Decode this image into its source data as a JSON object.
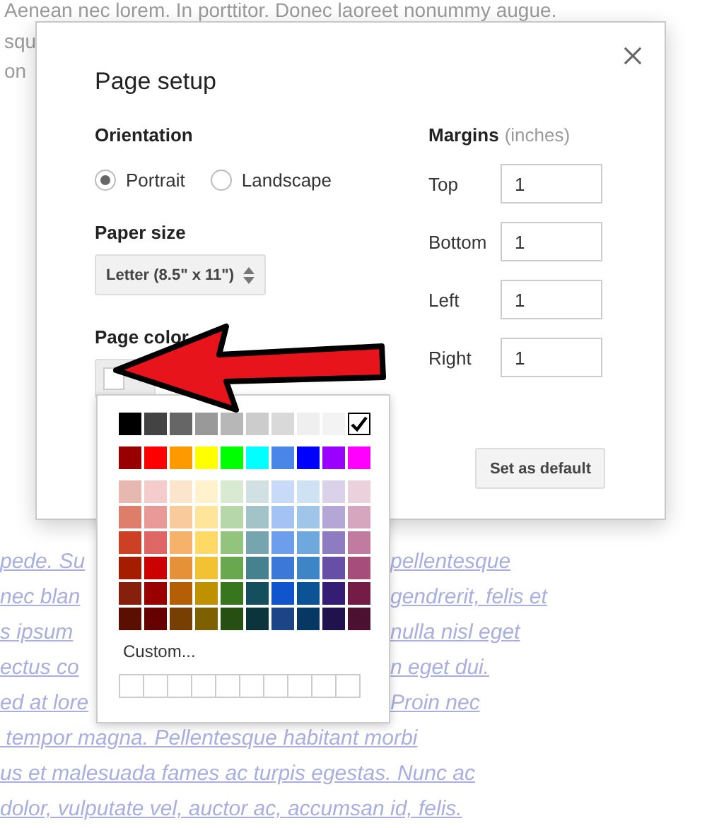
{
  "background_text": {
    "top_lines": [
      "Aenean nec lorem. In porttitor. Donec laoreet nonummy augue.",
      "squ",
      "on"
    ],
    "bottom_lines": [
      {
        "left": "pede. Su",
        "right": "pellentesque"
      },
      {
        "left": "nec blan",
        "right": "gendrerit, felis et"
      },
      {
        "left": "s ipsum",
        "right": "nulla nisl eget"
      },
      {
        "left": "ectus co",
        "right": "n eget dui."
      },
      {
        "left": "ed at lore",
        "right": "Proin nec"
      },
      {
        "left": " tempor magna. Pellentesque habitant morbi"
      },
      {
        "left": "us et malesuada fames ac turpis egestas. Nunc ac"
      },
      {
        "left": "dolor, vulputate vel, auctor ac, accumsan id, felis."
      }
    ]
  },
  "dialog": {
    "title": "Page setup",
    "orientation": {
      "label": "Orientation",
      "options": [
        {
          "label": "Portrait",
          "selected": true
        },
        {
          "label": "Landscape",
          "selected": false
        }
      ]
    },
    "paper_size": {
      "label": "Paper size",
      "value": "Letter (8.5\" x 11\")"
    },
    "page_color": {
      "label": "Page color",
      "color": "#ffffff"
    },
    "margins": {
      "label": "Margins",
      "unit": "(inches)",
      "fields": [
        {
          "label": "Top",
          "value": "1"
        },
        {
          "label": "Bottom",
          "value": "1"
        },
        {
          "label": "Left",
          "value": "1"
        },
        {
          "label": "Right",
          "value": "1"
        }
      ]
    },
    "buttons": [
      {
        "label": "Set as default"
      }
    ]
  },
  "color_menu": {
    "sections": [
      {
        "rows": [
          [
            {
              "color": "#000000",
              "selected": false
            },
            {
              "color": "#434343",
              "selected": false
            },
            {
              "color": "#666666",
              "selected": false
            },
            {
              "color": "#999999",
              "selected": false
            },
            {
              "color": "#b7b7b7",
              "selected": false
            },
            {
              "color": "#cccccc",
              "selected": false
            },
            {
              "color": "#d9d9d9",
              "selected": false
            },
            {
              "color": "#efefef",
              "selected": false
            },
            {
              "color": "#f3f3f3",
              "selected": false
            },
            {
              "color": "#ffffff",
              "selected": true
            }
          ]
        ]
      },
      {
        "rows": [
          [
            {
              "color": "#980000",
              "selected": false
            },
            {
              "color": "#ff0000",
              "selected": false
            },
            {
              "color": "#ff9900",
              "selected": false
            },
            {
              "color": "#ffff00",
              "selected": false
            },
            {
              "color": "#00ff00",
              "selected": false
            },
            {
              "color": "#00ffff",
              "selected": false
            },
            {
              "color": "#4a86e8",
              "selected": false
            },
            {
              "color": "#0000ff",
              "selected": false
            },
            {
              "color": "#9900ff",
              "selected": false
            },
            {
              "color": "#ff00ff",
              "selected": false
            }
          ]
        ]
      },
      {
        "rows": [
          [
            {
              "color": "#e6b8af",
              "selected": false
            },
            {
              "color": "#f4cccc",
              "selected": false
            },
            {
              "color": "#fce5cd",
              "selected": false
            },
            {
              "color": "#fff2cc",
              "selected": false
            },
            {
              "color": "#d9ead3",
              "selected": false
            },
            {
              "color": "#d0e0e3",
              "selected": false
            },
            {
              "color": "#c9daf8",
              "selected": false
            },
            {
              "color": "#cfe2f3",
              "selected": false
            },
            {
              "color": "#d9d2e9",
              "selected": false
            },
            {
              "color": "#ead1dc",
              "selected": false
            }
          ],
          [
            {
              "color": "#dd7e6b",
              "selected": false
            },
            {
              "color": "#ea9999",
              "selected": false
            },
            {
              "color": "#f9cb9c",
              "selected": false
            },
            {
              "color": "#ffe599",
              "selected": false
            },
            {
              "color": "#b6d7a8",
              "selected": false
            },
            {
              "color": "#a2c4c9",
              "selected": false
            },
            {
              "color": "#a4c2f4",
              "selected": false
            },
            {
              "color": "#9fc5e8",
              "selected": false
            },
            {
              "color": "#b4a7d6",
              "selected": false
            },
            {
              "color": "#d5a6bd",
              "selected": false
            }
          ],
          [
            {
              "color": "#cc4125",
              "selected": false
            },
            {
              "color": "#e06666",
              "selected": false
            },
            {
              "color": "#f6b26b",
              "selected": false
            },
            {
              "color": "#ffd966",
              "selected": false
            },
            {
              "color": "#93c47d",
              "selected": false
            },
            {
              "color": "#76a5af",
              "selected": false
            },
            {
              "color": "#6d9eeb",
              "selected": false
            },
            {
              "color": "#6fa8dc",
              "selected": false
            },
            {
              "color": "#8e7cc3",
              "selected": false
            },
            {
              "color": "#c27ba0",
              "selected": false
            }
          ],
          [
            {
              "color": "#a61c00",
              "selected": false
            },
            {
              "color": "#cc0000",
              "selected": false
            },
            {
              "color": "#e69138",
              "selected": false
            },
            {
              "color": "#f1c232",
              "selected": false
            },
            {
              "color": "#6aa84f",
              "selected": false
            },
            {
              "color": "#45818e",
              "selected": false
            },
            {
              "color": "#3c78d8",
              "selected": false
            },
            {
              "color": "#3d85c6",
              "selected": false
            },
            {
              "color": "#674ea7",
              "selected": false
            },
            {
              "color": "#a64d79",
              "selected": false
            }
          ],
          [
            {
              "color": "#85200c",
              "selected": false
            },
            {
              "color": "#990000",
              "selected": false
            },
            {
              "color": "#b45f06",
              "selected": false
            },
            {
              "color": "#bf9000",
              "selected": false
            },
            {
              "color": "#38761d",
              "selected": false
            },
            {
              "color": "#134f5c",
              "selected": false
            },
            {
              "color": "#1155cc",
              "selected": false
            },
            {
              "color": "#0b5394",
              "selected": false
            },
            {
              "color": "#351c75",
              "selected": false
            },
            {
              "color": "#741b47",
              "selected": false
            }
          ],
          [
            {
              "color": "#5b0f00",
              "selected": false
            },
            {
              "color": "#660000",
              "selected": false
            },
            {
              "color": "#783f04",
              "selected": false
            },
            {
              "color": "#7f6000",
              "selected": false
            },
            {
              "color": "#274e13",
              "selected": false
            },
            {
              "color": "#0c343d",
              "selected": false
            },
            {
              "color": "#1c4587",
              "selected": false
            },
            {
              "color": "#073763",
              "selected": false
            },
            {
              "color": "#20124d",
              "selected": false
            },
            {
              "color": "#4c1130",
              "selected": false
            }
          ]
        ]
      }
    ],
    "custom_label": "Custom..."
  }
}
